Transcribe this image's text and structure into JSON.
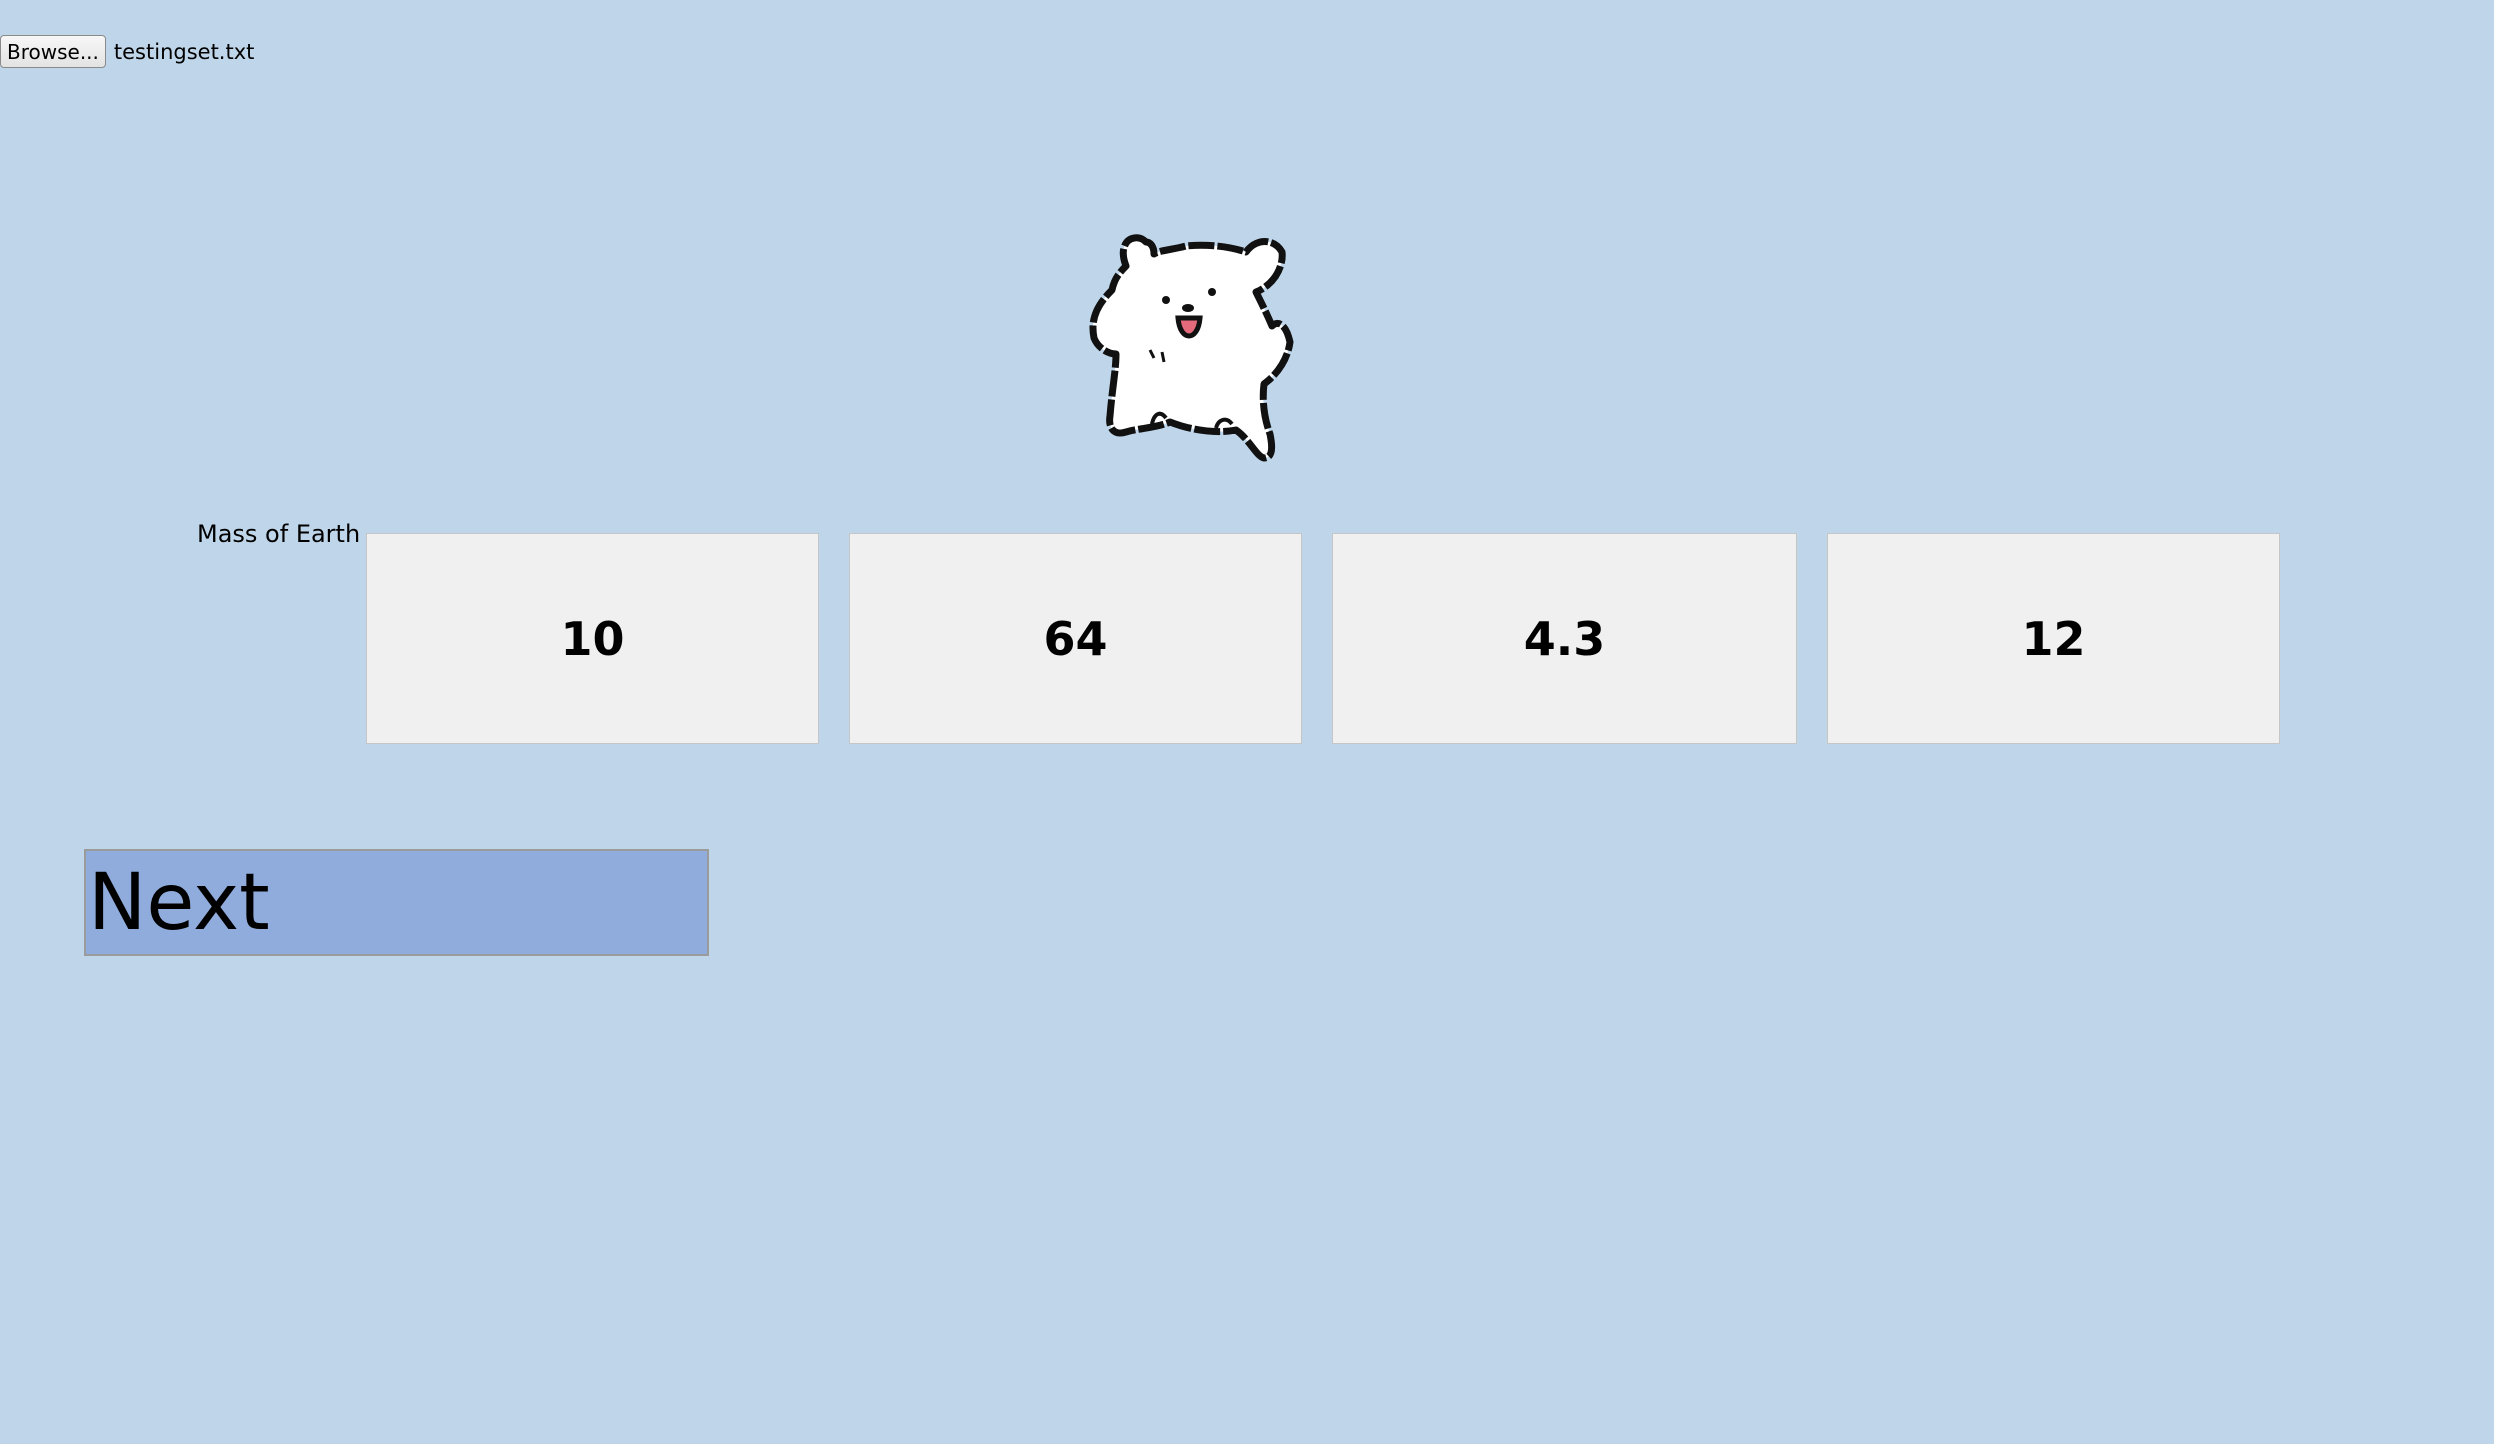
{
  "file_picker": {
    "browse_label": "Browse...",
    "file_name": "testingset.txt"
  },
  "mascot": {
    "icon": "polar-bear-icon"
  },
  "quiz": {
    "question": "Mass of Earth",
    "answers": [
      "10",
      "64",
      "4.3",
      "12"
    ]
  },
  "next": {
    "label": "Next"
  },
  "colors": {
    "background": "#bfd6ea",
    "answer_bg": "#f0f0f0",
    "next_bg": "#90acdc"
  }
}
